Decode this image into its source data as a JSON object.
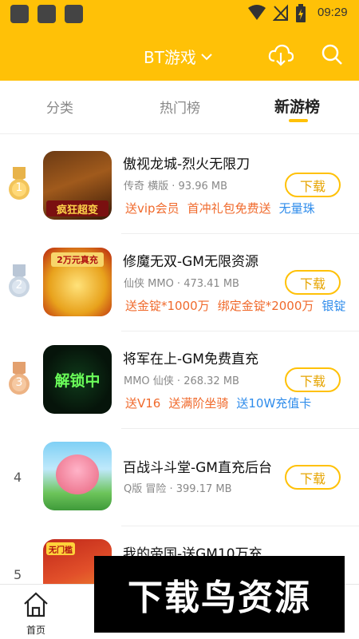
{
  "status_bar": {
    "time": "09:29"
  },
  "header": {
    "title": "BT游戏",
    "bg_color": "#FFC107"
  },
  "tabs": [
    {
      "label": "分类",
      "active": false
    },
    {
      "label": "热门榜",
      "active": false
    },
    {
      "label": "新游榜",
      "active": true
    }
  ],
  "download_label": "下载",
  "games": [
    {
      "rank": "1",
      "name": "傲视龙城-烈火无限刀",
      "meta": "传奇 横版 · 93.96 MB",
      "tags": [
        "送vip会员",
        "首冲礼包免费送",
        "无量珠"
      ],
      "thumb_text": "疯狂超变"
    },
    {
      "rank": "2",
      "name": "修魔无双-GM无限资源",
      "meta": "仙侠 MMO · 473.41 MB",
      "tags": [
        "送金锭*1000万",
        "绑定金锭*2000万",
        "银锭"
      ],
      "thumb_text": "2万元真充"
    },
    {
      "rank": "3",
      "name": "将军在上-GM免费直充",
      "meta": "MMO 仙侠 · 268.32 MB",
      "tags": [
        "送V16",
        "送满阶坐骑",
        "送10W充值卡"
      ],
      "thumb_text": "解锁中"
    },
    {
      "rank": "4",
      "name": "百战斗斗堂-GM直充后台",
      "meta": "Q版 冒险 · 399.17 MB",
      "tags": [],
      "thumb_text": ""
    },
    {
      "rank": "5",
      "name": "我的帝国-送GM10万充",
      "meta": "",
      "tags": [],
      "thumb_text": "无门槛"
    }
  ],
  "bottom_nav": {
    "home_label": "首页"
  },
  "watermark": "下载鸟资源",
  "tag_colors": [
    "#F06A2C",
    "#F06A2C",
    "#2F8CEB"
  ]
}
